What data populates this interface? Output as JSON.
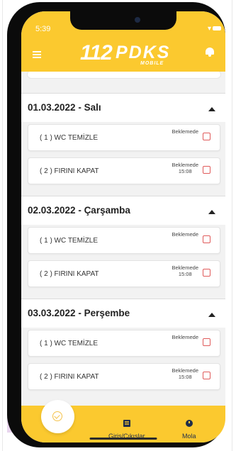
{
  "status_bar": {
    "time": "5:39"
  },
  "header": {
    "logo_number": "112",
    "logo_text": "PDKS",
    "logo_sub": "MOBILE"
  },
  "days": [
    {
      "title": "01.03.2022 - Salı",
      "tasks": [
        {
          "label": "( 1 ) WC TEMİZLE",
          "status": "Beklemede",
          "time": ""
        },
        {
          "label": "( 2 ) FIRINI KAPAT",
          "status": "Beklemede",
          "time": "15:08"
        }
      ]
    },
    {
      "title": "02.03.2022 - Çarşamba",
      "tasks": [
        {
          "label": "( 1 ) WC TEMİZLE",
          "status": "Beklemede",
          "time": ""
        },
        {
          "label": "( 2 ) FIRINI KAPAT",
          "status": "Beklemede",
          "time": "15:08"
        }
      ]
    },
    {
      "title": "03.03.2022 - Perşembe",
      "tasks": [
        {
          "label": "( 1 ) WC TEMİZLE",
          "status": "Beklemede",
          "time": ""
        },
        {
          "label": "( 2 ) FIRINI KAPAT",
          "status": "Beklemede",
          "time": "15:08"
        }
      ]
    }
  ],
  "tabbar": {
    "tab1_label": "Giriş/Çıkışlar",
    "tab2_label": "Mola"
  },
  "colors": {
    "accent": "#fbc92f",
    "checkbox_border": "#e05a5a",
    "nav_text": "#1f2d4a"
  }
}
